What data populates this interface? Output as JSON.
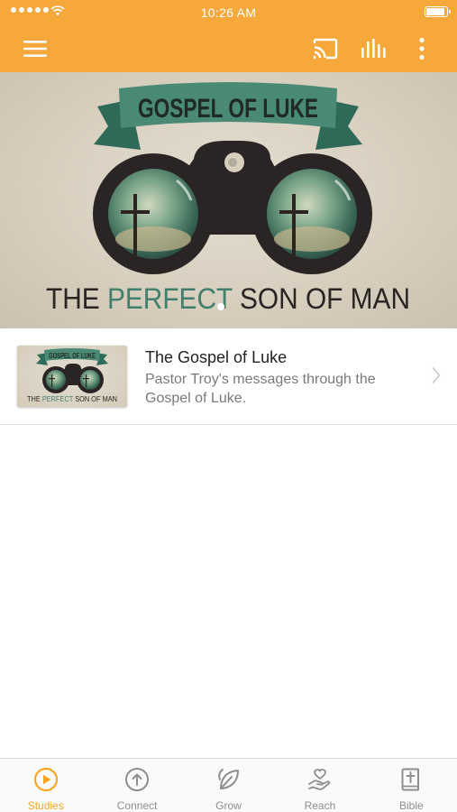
{
  "status_bar": {
    "time": "10:26 AM"
  },
  "toolbar": {
    "menu_icon": "hamburger-menu-icon",
    "cast_icon": "cast-icon",
    "audio_icon": "audio-bars-icon",
    "more_icon": "more-vertical-icon"
  },
  "banner": {
    "ribbon_text": "GOSPEL OF LUKE",
    "subtitle_prefix": "THE ",
    "subtitle_highlight": "PERFECT",
    "subtitle_suffix": " SON OF MAN",
    "pager_pages": 1,
    "pager_active": 1
  },
  "studies": [
    {
      "title": "The Gospel of Luke",
      "description": "Pastor Troy's messages through the Gospel of Luke.",
      "thumb_ribbon": "GOSPEL OF LUKE",
      "thumb_prefix": "THE ",
      "thumb_highlight": "PERFECT",
      "thumb_suffix": " SON OF MAN"
    }
  ],
  "tabs": [
    {
      "label": "Studies",
      "icon": "play-circle-icon",
      "active": true
    },
    {
      "label": "Connect",
      "icon": "arrow-up-circle-icon",
      "active": false
    },
    {
      "label": "Grow",
      "icon": "leaf-icon",
      "active": false
    },
    {
      "label": "Reach",
      "icon": "heart-hand-icon",
      "active": false
    },
    {
      "label": "Bible",
      "icon": "bible-cross-icon",
      "active": false
    }
  ],
  "colors": {
    "brand": "#f7a83b",
    "active_tab": "#f5a623",
    "ribbon_green": "#3f7f6b",
    "text_dark": "#222222",
    "text_muted": "#7a7a7a"
  }
}
